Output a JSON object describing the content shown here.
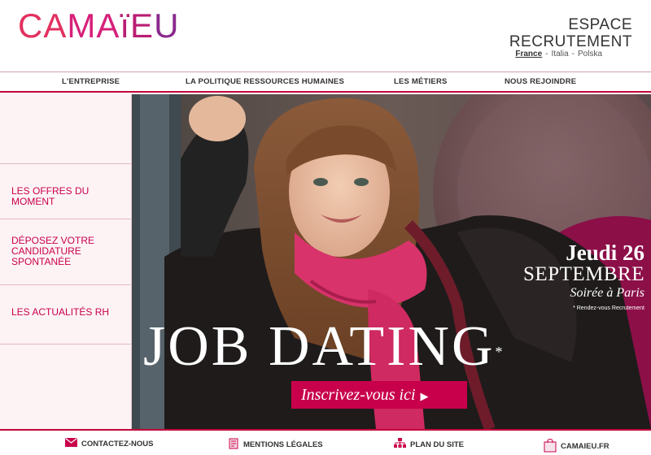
{
  "header": {
    "logo_parts": [
      "CA",
      "M",
      "A",
      "ï",
      "E",
      "U"
    ],
    "title_line1": "ESPACE",
    "title_line2": "RECRUTEMENT",
    "languages": [
      {
        "label": "France",
        "active": true
      },
      {
        "label": "Italia",
        "active": false
      },
      {
        "label": "Polska",
        "active": false
      }
    ],
    "lang_separator": "-"
  },
  "nav": {
    "items": [
      {
        "label": "L'ENTREPRISE"
      },
      {
        "label": "LA POLITIQUE RESSOURCES HUMAINES"
      },
      {
        "label": "LES MÉTIERS"
      },
      {
        "label": "NOUS REJOINDRE"
      }
    ]
  },
  "sidebar": {
    "items": [
      {
        "label": "LES OFFRES DU MOMENT"
      },
      {
        "line1": "DÉPOSEZ VOTRE",
        "line2": "CANDIDATURE",
        "line3": "SPONTANÉE"
      },
      {
        "label": "LES ACTUALITÉS RH"
      }
    ]
  },
  "hero": {
    "event_day": "Jeudi 26",
    "event_month": "SEPTEMBRE",
    "event_place": "Soirée à Paris",
    "event_note": "* Rendez-vous Recrutement",
    "headline": "JOB DATING",
    "headline_mark": "*",
    "cta_label": "Inscrivez-vous ici",
    "cta_arrow": "▶"
  },
  "footer": {
    "items": [
      {
        "label": "CONTACTEZ-NOUS",
        "icon": "envelope-icon"
      },
      {
        "label": "MENTIONS LÉGALES",
        "icon": "document-icon"
      },
      {
        "label": "PLAN DU SITE",
        "icon": "sitemap-icon"
      },
      {
        "label": "CAMAIEU.FR",
        "icon": "shopping-bag-icon"
      }
    ]
  },
  "colors": {
    "brand": "#c8004b",
    "sidebar_bg": "#fdf3f5",
    "text_dark": "#333333"
  }
}
